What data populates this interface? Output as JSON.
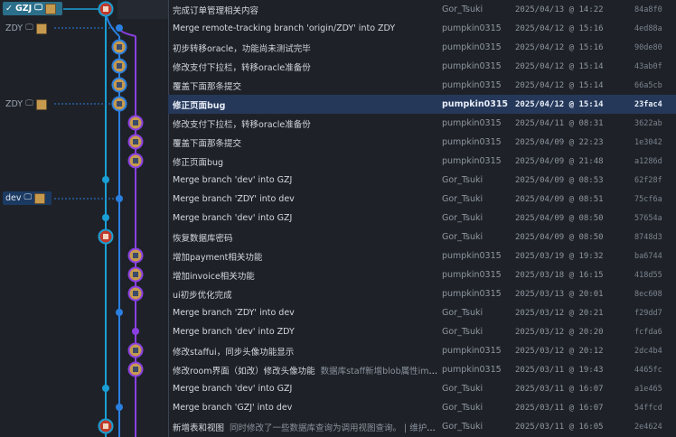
{
  "colors": {
    "lane_head": "#1a9fd4",
    "lane_zdy": "#2a7fe0",
    "lane_dev": "#8a3fe0",
    "lane_gzj": "#1a9fd4"
  },
  "branches": {
    "gzj": {
      "check": "✓",
      "name": "GZJ",
      "icons": [
        "computer-icon",
        "avatar-icon"
      ]
    },
    "zdy_top": {
      "name": "ZDY",
      "icons": [
        "computer-icon",
        "avatar-icon"
      ]
    },
    "zdy_sel": {
      "name": "ZDY",
      "icons": [
        "computer-icon",
        "avatar-icon"
      ]
    },
    "dev": {
      "name": "dev",
      "icons": [
        "computer-icon",
        "avatar-icon"
      ]
    }
  },
  "commits": [
    {
      "msg": "完成订单管理相关内容",
      "sub": "",
      "author": "Gor_Tsuki",
      "date": "2025/04/13 @ 14:22",
      "sha": "84a8f0"
    },
    {
      "msg": "Merge remote-tracking branch 'origin/ZDY' into ZDY",
      "sub": "",
      "author": "pumpkin0315",
      "date": "2025/04/12 @ 15:16",
      "sha": "4ed88a"
    },
    {
      "msg": "初步转移oracle，功能尚未测试完毕",
      "sub": "",
      "author": "pumpkin0315",
      "date": "2025/04/12 @ 15:16",
      "sha": "90de80"
    },
    {
      "msg": "修改支付下拉栏，转移oracle准备份",
      "sub": "",
      "author": "pumpkin0315",
      "date": "2025/04/12 @ 15:14",
      "sha": "43ab0f"
    },
    {
      "msg": "覆盖下面那条提交",
      "sub": "",
      "author": "pumpkin0315",
      "date": "2025/04/12 @ 15:14",
      "sha": "66a5cb"
    },
    {
      "msg": "修正页面bug",
      "sub": "",
      "author": "pumpkin0315",
      "date": "2025/04/12 @ 15:14",
      "sha": "23fac4"
    },
    {
      "msg": "修改支付下拉栏，转移oracle准备份",
      "sub": "",
      "author": "pumpkin0315",
      "date": "2025/04/11 @ 08:31",
      "sha": "3622ab"
    },
    {
      "msg": "覆盖下面那条提交",
      "sub": "",
      "author": "pumpkin0315",
      "date": "2025/04/09 @ 22:23",
      "sha": "1e3042"
    },
    {
      "msg": "修正页面bug",
      "sub": "",
      "author": "pumpkin0315",
      "date": "2025/04/09 @ 21:48",
      "sha": "a1286d"
    },
    {
      "msg": "Merge branch 'dev' into GZJ",
      "sub": "",
      "author": "Gor_Tsuki",
      "date": "2025/04/09 @ 08:53",
      "sha": "62f28f"
    },
    {
      "msg": "Merge branch 'ZDY' into dev",
      "sub": "",
      "author": "Gor_Tsuki",
      "date": "2025/04/09 @ 08:51",
      "sha": "75cf6a"
    },
    {
      "msg": "Merge branch 'dev' into GZJ",
      "sub": "",
      "author": "Gor_Tsuki",
      "date": "2025/04/09 @ 08:50",
      "sha": "57654a"
    },
    {
      "msg": "恢复数据库密码",
      "sub": "",
      "author": "Gor_Tsuki",
      "date": "2025/04/09 @ 08:50",
      "sha": "8748d3"
    },
    {
      "msg": "增加payment相关功能",
      "sub": "",
      "author": "pumpkin0315",
      "date": "2025/03/19 @ 19:32",
      "sha": "ba6744"
    },
    {
      "msg": "增加invoice相关功能",
      "sub": "",
      "author": "pumpkin0315",
      "date": "2025/03/18 @ 16:15",
      "sha": "418d55"
    },
    {
      "msg": "ui初步优化完成",
      "sub": "",
      "author": "pumpkin0315",
      "date": "2025/03/13 @ 20:01",
      "sha": "8ec608"
    },
    {
      "msg": "Merge branch 'ZDY' into dev",
      "sub": "",
      "author": "Gor_Tsuki",
      "date": "2025/03/12 @ 20:21",
      "sha": "f29dd7"
    },
    {
      "msg": "Merge branch 'dev' into ZDY",
      "sub": "",
      "author": "Gor_Tsuki",
      "date": "2025/03/12 @ 20:20",
      "sha": "fcfda6"
    },
    {
      "msg": "修改staffui，同步头像功能显示",
      "sub": "",
      "author": "pumpkin0315",
      "date": "2025/03/12 @ 20:12",
      "sha": "2dc4b4"
    },
    {
      "msg": "修改room界面（如改）修改头像功能",
      "sub": "数据库staff新增blob属性image...",
      "author": "pumpkin0315",
      "date": "2025/03/11 @ 19:43",
      "sha": "4465fc"
    },
    {
      "msg": "Merge branch 'dev' into GZJ",
      "sub": "",
      "author": "Gor_Tsuki",
      "date": "2025/03/11 @ 16:07",
      "sha": "a1e465"
    },
    {
      "msg": "Merge branch 'GZJ' into dev",
      "sub": "",
      "author": "Gor_Tsuki",
      "date": "2025/03/11 @ 16:07",
      "sha": "54ffcd"
    },
    {
      "msg": "新增表和视图",
      "sub": "同时修改了一些数据库查询为调用视图查询。 | 维护了c...",
      "author": "Gor_Tsuki",
      "date": "2025/03/11 @ 16:05",
      "sha": "2e4624"
    }
  ]
}
